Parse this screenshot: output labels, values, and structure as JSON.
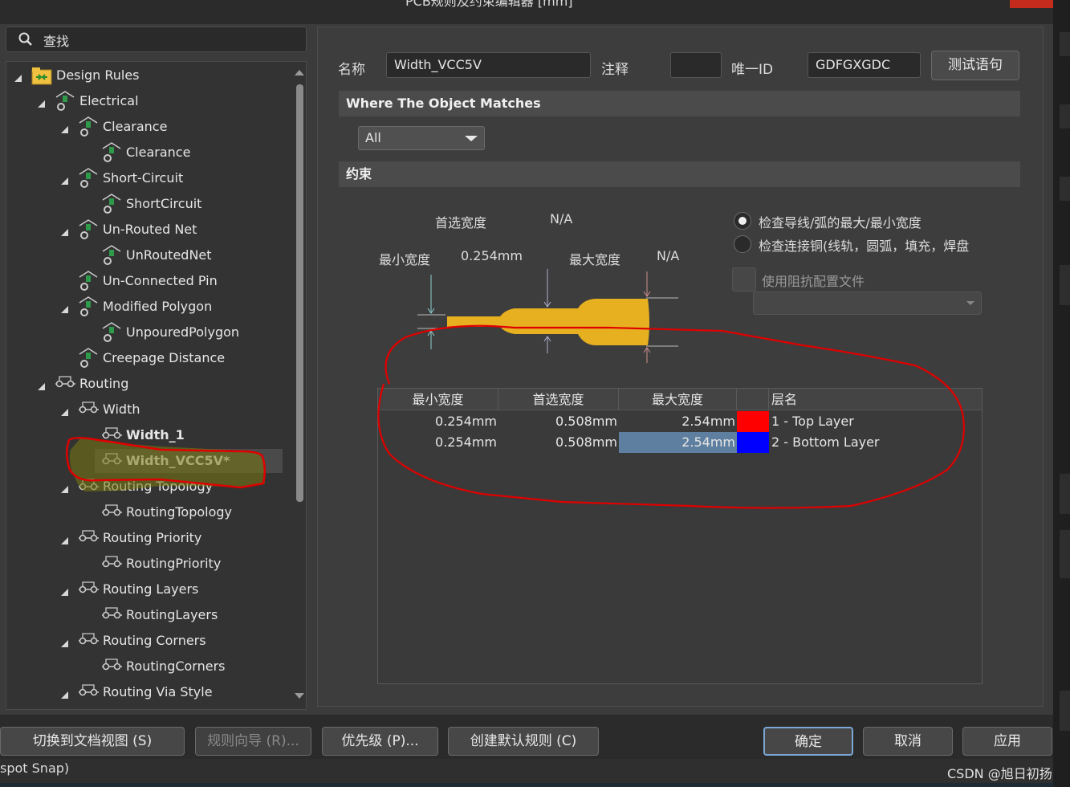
{
  "window": {
    "title": "PCB规则及约束编辑器 [mm]"
  },
  "search": {
    "placeholder": "查找"
  },
  "tree": {
    "items": [
      {
        "label": "Design Rules",
        "icon": "design-rules-icon",
        "bold": false
      },
      {
        "label": "Electrical",
        "icon": "rule-category-icon",
        "bold": false
      },
      {
        "label": "Clearance",
        "icon": "rule-type-icon",
        "bold": false
      },
      {
        "label": "Clearance",
        "icon": "rule-icon",
        "bold": false
      },
      {
        "label": "Short-Circuit",
        "icon": "rule-type-icon",
        "bold": false
      },
      {
        "label": "ShortCircuit",
        "icon": "rule-icon",
        "bold": false
      },
      {
        "label": "Un-Routed Net",
        "icon": "rule-type-icon",
        "bold": false
      },
      {
        "label": "UnRoutedNet",
        "icon": "rule-icon",
        "bold": false
      },
      {
        "label": "Un-Connected Pin",
        "icon": "rule-type-icon",
        "bold": false
      },
      {
        "label": "Modified Polygon",
        "icon": "rule-type-icon",
        "bold": false
      },
      {
        "label": "UnpouredPolygon",
        "icon": "rule-icon",
        "bold": false
      },
      {
        "label": "Creepage Distance",
        "icon": "rule-type-icon",
        "bold": false
      },
      {
        "label": "Routing",
        "icon": "routing-icon",
        "bold": false
      },
      {
        "label": "Width",
        "icon": "routing-icon",
        "bold": false
      },
      {
        "label": "Width_1",
        "icon": "routing-rule-icon",
        "bold": true
      },
      {
        "label": "Width_VCC5V*",
        "icon": "routing-rule-icon",
        "bold": true
      },
      {
        "label": "Routing Topology",
        "icon": "routing-icon",
        "bold": false
      },
      {
        "label": "RoutingTopology",
        "icon": "routing-rule-icon",
        "bold": false
      },
      {
        "label": "Routing Priority",
        "icon": "routing-icon",
        "bold": false
      },
      {
        "label": "RoutingPriority",
        "icon": "routing-rule-icon",
        "bold": false
      },
      {
        "label": "Routing Layers",
        "icon": "routing-icon",
        "bold": false
      },
      {
        "label": "RoutingLayers",
        "icon": "routing-rule-icon",
        "bold": false
      },
      {
        "label": "Routing Corners",
        "icon": "routing-icon",
        "bold": false
      },
      {
        "label": "RoutingCorners",
        "icon": "routing-rule-icon",
        "bold": false
      },
      {
        "label": "Routing Via Style",
        "icon": "routing-icon",
        "bold": false
      }
    ]
  },
  "rule": {
    "name_label": "名称",
    "name_value": "Width_VCC5V",
    "comment_label": "注释",
    "comment_value": "",
    "uid_label": "唯一ID",
    "uid_value": "GDFGXGDC",
    "test_button": "测试语句"
  },
  "where": {
    "section_title": "Where The Object Matches",
    "scope": "All"
  },
  "constraints": {
    "section_title": "约束",
    "preferred_width_label": "首选宽度",
    "preferred_width_value": "N/A",
    "min_width_label": "最小宽度",
    "min_width_value": "0.254mm",
    "max_width_label": "最大宽度",
    "max_width_value": "N/A",
    "radio_1": "检查导线/弧的最大/最小宽度",
    "radio_2": "检查连接铜(线轨，圆弧，填充，焊盘",
    "checkbox_label": "使用阻抗配置文件",
    "impedance_profile": ""
  },
  "layer_table": {
    "headers": [
      "最小宽度",
      "首选宽度",
      "最大宽度",
      "层名"
    ],
    "rows": [
      {
        "min": "0.254mm",
        "pref": "0.508mm",
        "max": "2.54mm",
        "color": "#ff0000",
        "layer": "1 - Top Layer"
      },
      {
        "min": "0.254mm",
        "pref": "0.508mm",
        "max": "2.54mm",
        "color": "#0000ff",
        "layer": "2 - Bottom Layer"
      }
    ]
  },
  "buttons": {
    "doc_view": "切换到文档视图 (S)",
    "rule_wizard": "规则向导 (R)...",
    "priority": "优先级 (P)...",
    "create_default": "创建默认规则 (C)",
    "ok": "确定",
    "cancel": "取消",
    "apply": "应用"
  },
  "status": {
    "text": "spot Snap)"
  },
  "watermark": "CSDN @旭日初扬",
  "colors": {
    "accent": "#7aa7d4",
    "track": "#e6b020",
    "annotation": "#e00000"
  }
}
